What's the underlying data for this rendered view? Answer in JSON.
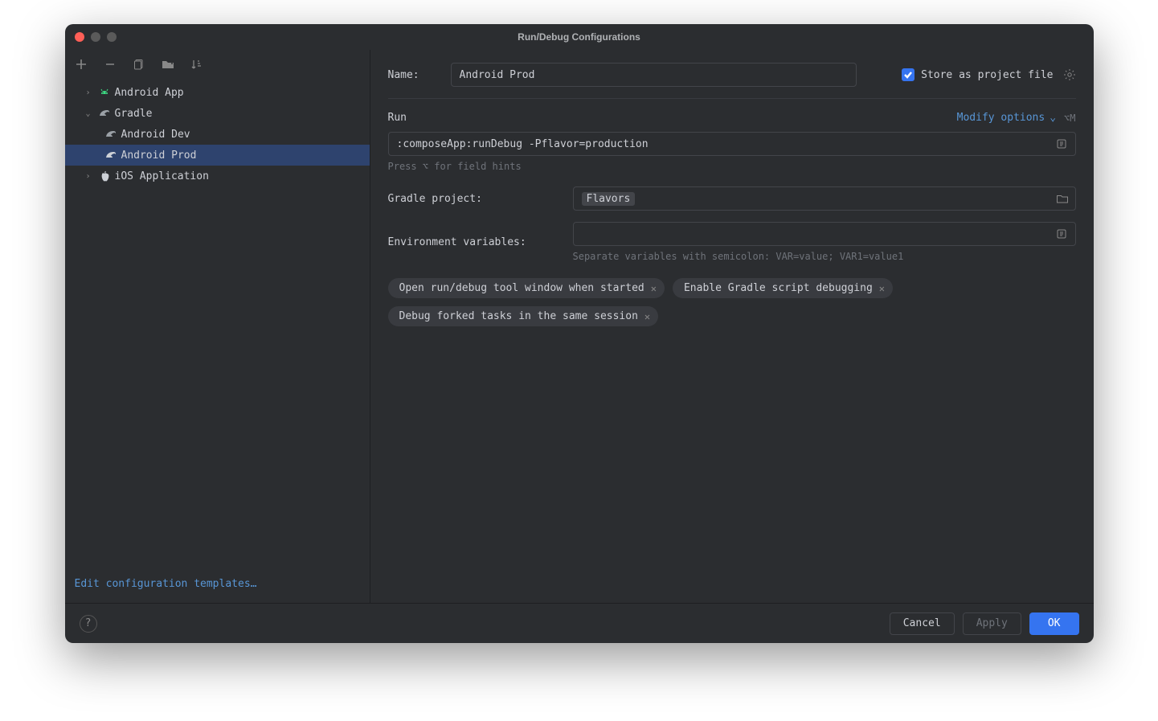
{
  "window": {
    "title": "Run/Debug Configurations"
  },
  "toolbar": {
    "add": "+",
    "remove": "−"
  },
  "tree": {
    "items": [
      {
        "label": "Android App",
        "kind": "android",
        "expanded": false,
        "depth": 1
      },
      {
        "label": "Gradle",
        "kind": "gradle",
        "expanded": true,
        "depth": 1
      },
      {
        "label": "Android Dev",
        "kind": "gradle",
        "depth": 2
      },
      {
        "label": "Android Prod",
        "kind": "gradle",
        "depth": 2,
        "selected": true
      },
      {
        "label": "iOS Application",
        "kind": "ios",
        "expanded": false,
        "depth": 1
      }
    ]
  },
  "sidebar": {
    "edit_templates": "Edit configuration templates…"
  },
  "form": {
    "name_label": "Name:",
    "name_value": "Android Prod",
    "store_label": "Store as project file",
    "run_label": "Run",
    "modify_label": "Modify options",
    "modify_shortcut": "⌥M",
    "run_value": ":composeApp:runDebug -Pflavor=production",
    "run_hint": "Press ⌥ for field hints",
    "gradle_label": "Gradle project:",
    "gradle_value": "Flavors",
    "env_label": "Environment variables:",
    "env_value": "",
    "env_hint": "Separate variables with semicolon: VAR=value; VAR1=value1",
    "chips": [
      "Open run/debug tool window when started",
      "Enable Gradle script debugging",
      "Debug forked tasks in the same session"
    ]
  },
  "footer": {
    "cancel": "Cancel",
    "apply": "Apply",
    "ok": "OK"
  }
}
